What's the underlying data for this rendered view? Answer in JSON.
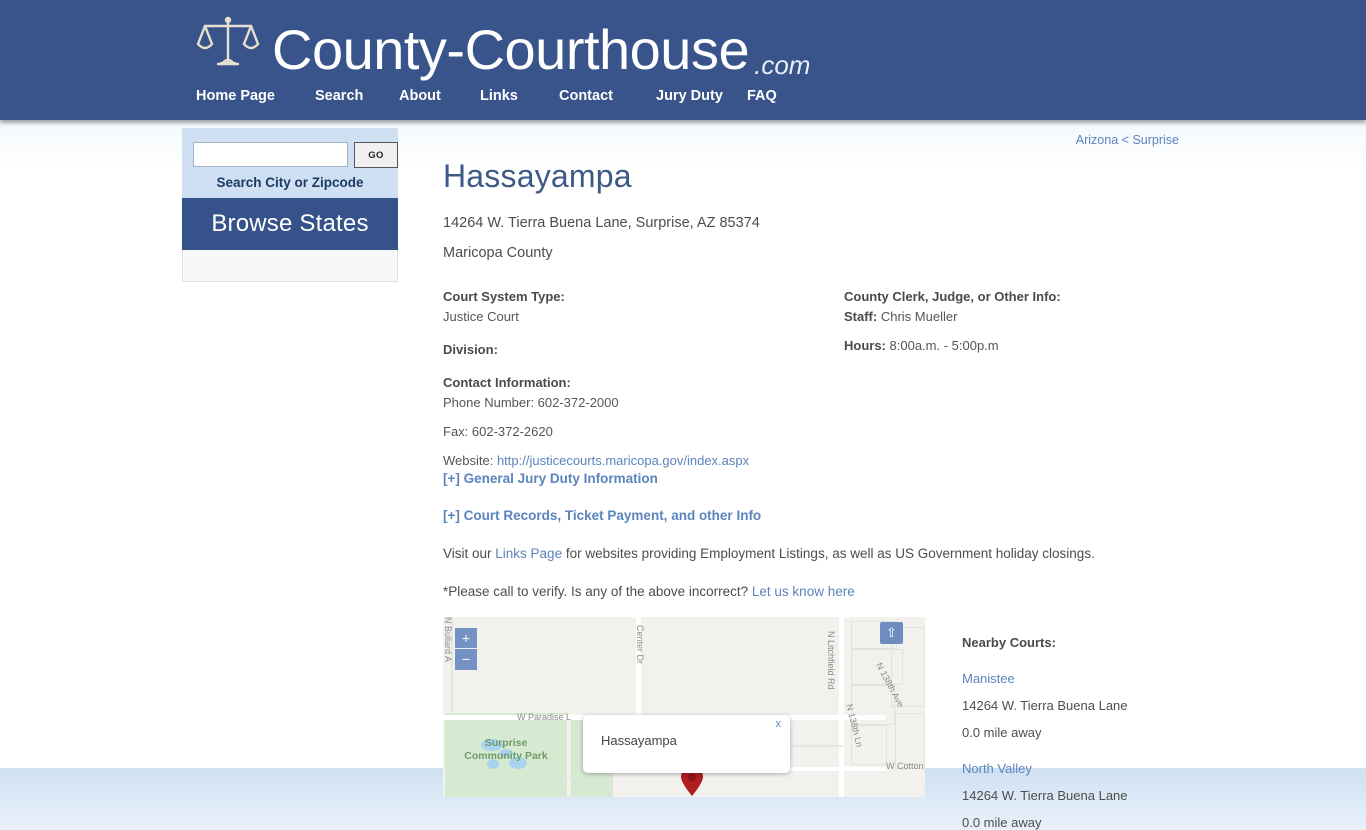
{
  "header": {
    "brand_name": "County-Courthouse",
    "brand_tld": ".com",
    "logo_icon": "scales-of-justice-icon",
    "nav": [
      {
        "label": "Home Page"
      },
      {
        "label": "Search"
      },
      {
        "label": "About"
      },
      {
        "label": "Links"
      },
      {
        "label": "Contact"
      },
      {
        "label": "Jury Duty"
      },
      {
        "label": "FAQ"
      }
    ]
  },
  "sidebar": {
    "search_value": "",
    "search_placeholder": "",
    "go_label": "GO",
    "search_caption": "Search City or Zipcode",
    "browse_states_label": "Browse States"
  },
  "breadcrumb": {
    "state": "Arizona",
    "separator": "<",
    "city": "Surprise"
  },
  "court": {
    "name": "Hassayampa",
    "address": "14264 W. Tierra Buena Lane, Surprise, AZ 85374",
    "county": "Maricopa County",
    "system_type_label": "Court System Type:",
    "system_type_value": "Justice Court",
    "division_label": "Division:",
    "division_value": "",
    "contact_label": "Contact Information:",
    "phone": "Phone Number: 602-372-2000",
    "fax": "Fax: 602-372-2620",
    "website_prefix": "Website: ",
    "website_url": "http://justicecourts.maricopa.gov/index.aspx",
    "clerk_label": "County Clerk, Judge, or Other Info:",
    "staff_label": "Staff:",
    "staff_value": "Chris Mueller",
    "hours_label": "Hours:",
    "hours_value": "8:00a.m. - 5:00p.m"
  },
  "expanders": [
    {
      "label": "[+] General Jury Duty Information"
    },
    {
      "label": "[+] Court Records, Ticket Payment, and other Info"
    }
  ],
  "paragraphs": {
    "links_prefix": "Visit our ",
    "links_anchor": "Links Page",
    "links_suffix": " for websites providing Employment Listings, as well as US Government holiday closings.",
    "verify_prefix": "*Please call to verify. Is any of the above incorrect? ",
    "verify_anchor": "Let us know here"
  },
  "map": {
    "zoom_in_label": "+",
    "zoom_out_label": "−",
    "pan_label": "⇧",
    "infowindow_title": "Hassayampa",
    "infowindow_close": "x",
    "labels": [
      {
        "text": "N Bullard A"
      },
      {
        "text": "Center Dr"
      },
      {
        "text": "W Paradise L"
      },
      {
        "text": "N Litchfield Rd"
      },
      {
        "text": "N 138th Ave"
      },
      {
        "text": "N 138th Ln"
      },
      {
        "text": "W Cotton"
      }
    ],
    "park_label_line1": "Surprise",
    "park_label_line2": "Community Park"
  },
  "nearby": {
    "title": "Nearby Courts:",
    "items": [
      {
        "name": "Manistee",
        "address": "14264 W. Tierra Buena Lane",
        "distance": "0.0 mile away"
      },
      {
        "name": "North Valley",
        "address": "14264 W. Tierra Buena Lane",
        "distance": "0.0 mile away"
      }
    ]
  },
  "colors": {
    "header_blue": "#39548a",
    "panel_blue": "#cfe0f2",
    "browse_blue": "#35538a",
    "link_blue": "#5b84bd",
    "title_blue": "#3d5a87",
    "body_text": "#4d4d4d"
  }
}
